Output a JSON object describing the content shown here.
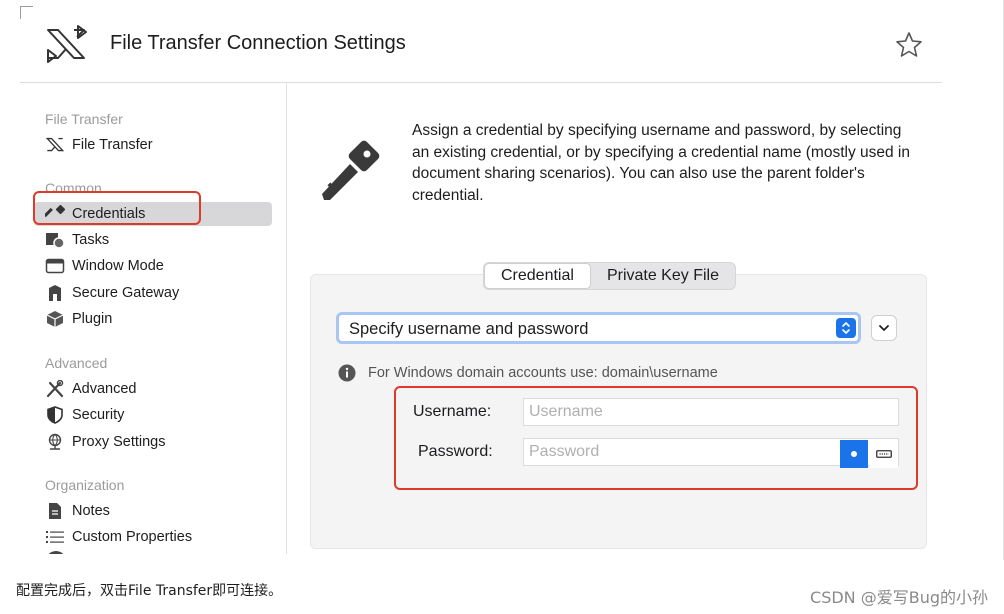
{
  "header": {
    "title": "File Transfer Connection Settings",
    "app_icon": "file-transfer-icon",
    "favorite_icon": "star-icon"
  },
  "sidebar": {
    "sections": [
      {
        "title": "File Transfer",
        "items": [
          {
            "label": "File Transfer",
            "icon": "file-transfer-icon"
          }
        ]
      },
      {
        "title": "Common",
        "items": [
          {
            "label": "Credentials",
            "icon": "key-icon",
            "selected": true
          },
          {
            "label": "Tasks",
            "icon": "tasks-icon"
          },
          {
            "label": "Window Mode",
            "icon": "window-icon"
          },
          {
            "label": "Secure Gateway",
            "icon": "gateway-icon"
          },
          {
            "label": "Plugin",
            "icon": "plugin-icon"
          }
        ]
      },
      {
        "title": "Advanced",
        "items": [
          {
            "label": "Advanced",
            "icon": "tools-icon"
          },
          {
            "label": "Security",
            "icon": "shield-icon"
          },
          {
            "label": "Proxy Settings",
            "icon": "proxy-icon"
          }
        ]
      },
      {
        "title": "Organization",
        "items": [
          {
            "label": "Notes",
            "icon": "notes-icon"
          },
          {
            "label": "Custom Properties",
            "icon": "list-icon"
          }
        ]
      }
    ]
  },
  "main": {
    "description": "Assign a credential by specifying username and password, by selecting an existing credential, or by specifying a credential name (mostly used in document sharing scenarios). You can also use the parent folder's credential.",
    "tabs": [
      {
        "label": "Credential",
        "active": true
      },
      {
        "label": "Private Key File",
        "active": false
      }
    ],
    "mode_select": {
      "value": "Specify username and password"
    },
    "info_text": "For Windows domain accounts use: domain\\username",
    "username": {
      "label": "Username:",
      "placeholder": "Username",
      "value": ""
    },
    "password": {
      "label": "Password:",
      "placeholder": "Password",
      "value": ""
    }
  },
  "footer": {
    "note": "配置完成后，双击File Transfer即可连接。",
    "watermark": "CSDN @爱写Bug的小孙"
  },
  "colors": {
    "accent": "#1a73e8",
    "highlight": "#dd3a2a",
    "selected_bg": "#d7d7d9"
  }
}
